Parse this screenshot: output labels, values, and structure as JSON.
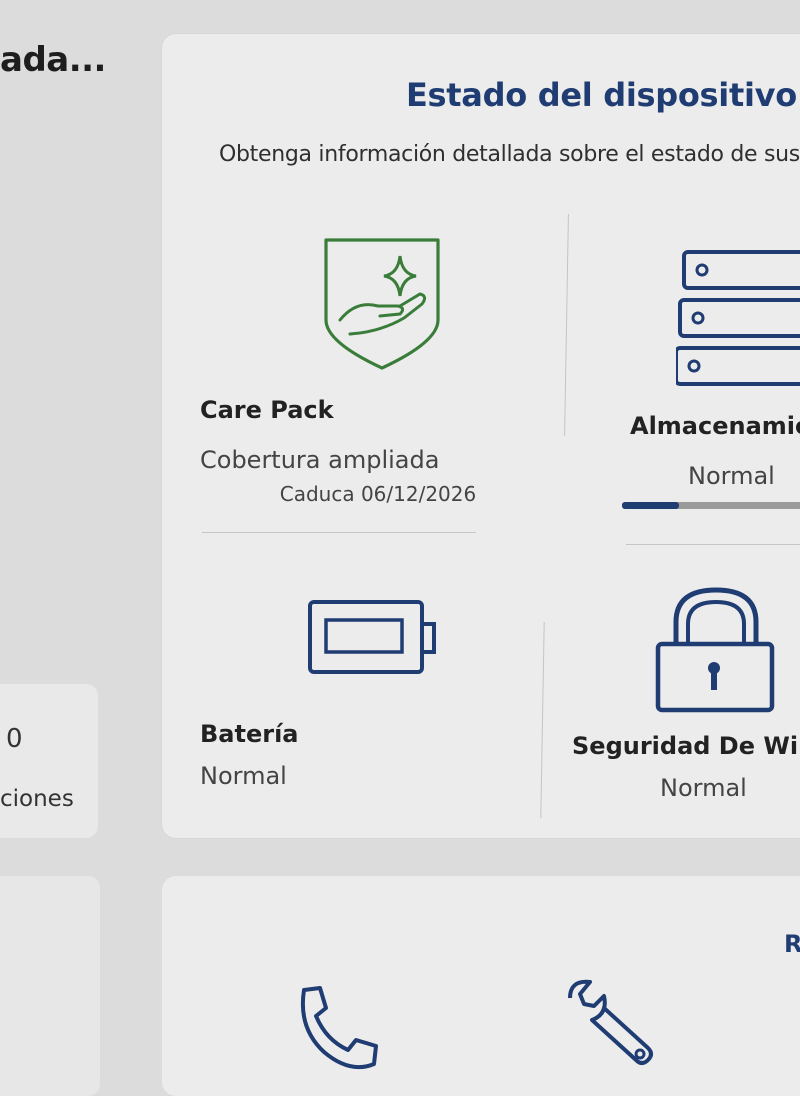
{
  "left": {
    "header_title": "ada...",
    "card_value": "0",
    "card_label": "ciones"
  },
  "panel": {
    "title": "Estado del dispositivo ›",
    "subtitle": "Obtenga información detallada sobre el estado de sus"
  },
  "tiles": {
    "care_pack": {
      "title": "Care Pack",
      "line1": "Cobertura ampliada",
      "line2": "Caduca 06/12/2026",
      "icon": "shield-hand-star-icon"
    },
    "storage": {
      "title": "Almacenamie",
      "status": "Normal",
      "usage_fraction": 0.3,
      "icon": "storage-drives-icon"
    },
    "battery": {
      "title": "Batería",
      "status": "Normal",
      "icon": "battery-icon"
    },
    "windows_security": {
      "title": "Seguridad De Wind",
      "status": "Normal",
      "icon": "padlock-icon"
    }
  },
  "bottom": {
    "right_letter": "R",
    "icons": [
      "phone-icon",
      "wrench-icon"
    ]
  },
  "colors": {
    "accent": "#1f3c73",
    "care_pack_green": "#3a7d3a",
    "panel_bg": "#ececec",
    "page_bg": "#dcdcdc"
  }
}
